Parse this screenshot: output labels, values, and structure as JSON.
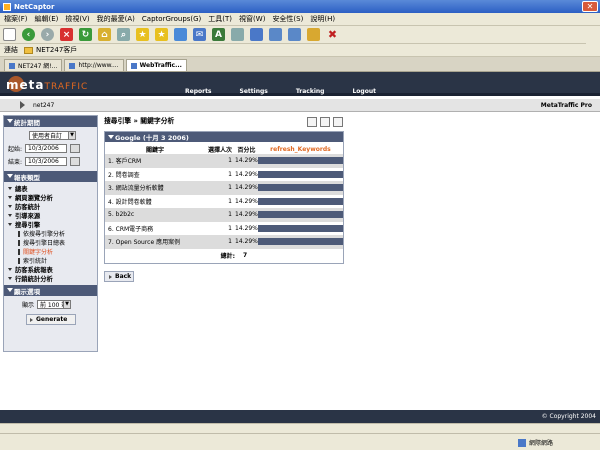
{
  "window": {
    "title": "NetCaptor"
  },
  "menu": [
    "檔案(F)",
    "編輯(E)",
    "檢視(V)",
    "我的最愛(A)",
    "CaptorGroups(G)",
    "工具(T)",
    "視窗(W)",
    "安全性(S)",
    "說明(H)"
  ],
  "links": {
    "label": "連結",
    "item": "NET247客戶"
  },
  "tabs": [
    {
      "label": "NET247 網!..."
    },
    {
      "label": "http://www...."
    },
    {
      "label": "WebTraffic..."
    }
  ],
  "app": {
    "logo_meta": "meta",
    "logo_traffic": "TRAFFIC",
    "nav": [
      "Reports",
      "Settings",
      "Tracking",
      "Logout"
    ],
    "account": "net247",
    "product": "MetaTraffic Pro"
  },
  "sidebar": {
    "period_header": "統計期間",
    "period_select": "使用者自訂",
    "start_label": "起始:",
    "start_date": "10/3/2006",
    "end_label": "結束:",
    "end_date": "10/3/2006",
    "report_header": "報表類型",
    "menu": [
      {
        "label": "總表",
        "type": "main"
      },
      {
        "label": "網頁瀏覽分析",
        "type": "main"
      },
      {
        "label": "訪客統計",
        "type": "main"
      },
      {
        "label": "引導來源",
        "type": "main"
      },
      {
        "label": "搜尋引擎",
        "type": "main"
      },
      {
        "label": "依搜尋引擎分析",
        "type": "sub"
      },
      {
        "label": "搜尋引擎日總表",
        "type": "sub"
      },
      {
        "label": "關鍵字分析",
        "type": "sub",
        "active": true
      },
      {
        "label": "索引統計",
        "type": "sub"
      },
      {
        "label": "訪客系統報表",
        "type": "main"
      },
      {
        "label": "行銷統計分析",
        "type": "main"
      }
    ],
    "display_header": "顯示選項",
    "display_label": "顯示",
    "display_select": "前 100 筆",
    "generate_label": "Generate"
  },
  "main": {
    "breadcrumb": "搜尋引擎 » 關鍵字分析",
    "panel_title": "Google (十月 3 2006)",
    "columns": {
      "keyword": "關鍵字",
      "visitors": "選擇人次",
      "percent": "百分比",
      "refresh": "refresh_Keywords"
    },
    "rows": [
      {
        "keyword": "1. 客戶CRM",
        "visitors": "1",
        "percent": "14.29%"
      },
      {
        "keyword": "2. 問卷調查",
        "visitors": "1",
        "percent": "14.29%"
      },
      {
        "keyword": "3. 網站流量分析軟體",
        "visitors": "1",
        "percent": "14.29%"
      },
      {
        "keyword": "4. 設計問卷軟體",
        "visitors": "1",
        "percent": "14.29%"
      },
      {
        "keyword": "5. b2b2c",
        "visitors": "1",
        "percent": "14.29%"
      },
      {
        "keyword": "6. CRM電子商務",
        "visitors": "1",
        "percent": "14.29%"
      },
      {
        "keyword": "7. Open Source 應用案例",
        "visitors": "1",
        "percent": "14.29%"
      }
    ],
    "total_label": "總計:",
    "total_value": "7",
    "back_label": "Back"
  },
  "footer": {
    "copyright": "© Copyright 2004"
  },
  "status": {
    "zone": "網際網路"
  }
}
